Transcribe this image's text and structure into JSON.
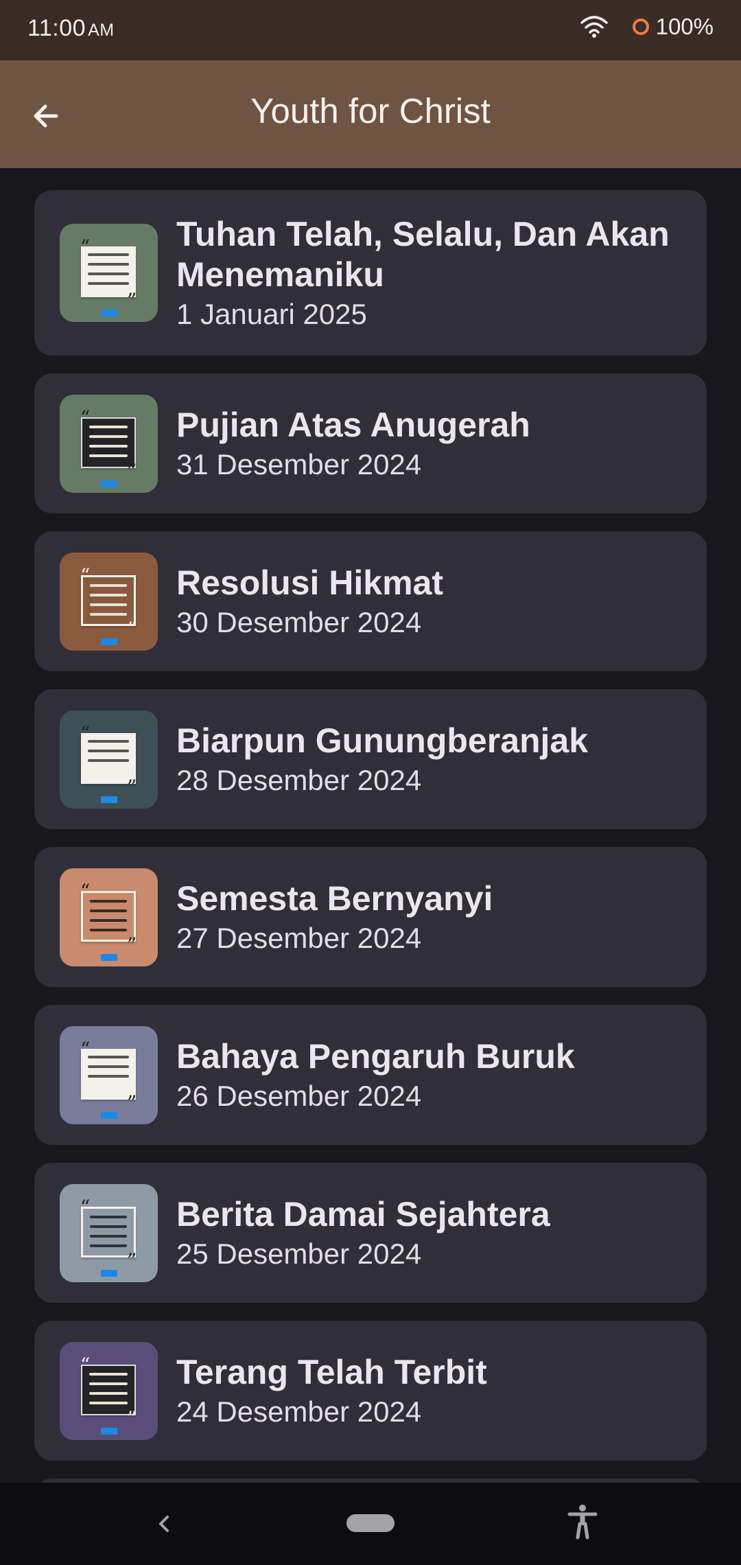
{
  "status_bar": {
    "time": "11:00",
    "time_suffix": "AM",
    "battery": "100%"
  },
  "app_bar": {
    "title": "Youth for Christ"
  },
  "colors": {
    "status_bar": "#3a2b24",
    "app_bar": "#6f5444",
    "background": "#18171c",
    "card": "#302e38",
    "battery_ring": "#f07a45"
  },
  "devotionals": [
    {
      "title": "Tuhan Telah, Selalu, Dan Akan Menemaniku",
      "date": "1 Januari 2025",
      "thumb_color": "#667b66",
      "thumb_style": "paper"
    },
    {
      "title": "Pujian Atas Anugerah",
      "date": "31 Desember 2024",
      "thumb_color": "#667b66",
      "thumb_style": "dark"
    },
    {
      "title": "Resolusi Hikmat",
      "date": "30 Desember 2024",
      "thumb_color": "#8a5a3e",
      "thumb_style": "frame"
    },
    {
      "title": "Biarpun Gunungberanjak",
      "date": "28 Desember 2024",
      "thumb_color": "#3d5056",
      "thumb_style": "paper"
    },
    {
      "title": "Semesta Bernyanyi",
      "date": "27 Desember 2024",
      "thumb_color": "#c98a6e",
      "thumb_style": "frame-dark-text"
    },
    {
      "title": "Bahaya Pengaruh Buruk",
      "date": "26 Desember 2024",
      "thumb_color": "#7a7c9c",
      "thumb_style": "paper"
    },
    {
      "title": "Berita Damai Sejahtera",
      "date": "25 Desember 2024",
      "thumb_color": "#8e9ba6",
      "thumb_style": "frame-dark-text"
    },
    {
      "title": "Terang Telah Terbit",
      "date": "24 Desember 2024",
      "thumb_color": "#5b4d7a",
      "thumb_style": "dark"
    }
  ],
  "nav_bar": {
    "icons": [
      "back-icon",
      "home-pill-icon",
      "accessibility-icon"
    ]
  }
}
